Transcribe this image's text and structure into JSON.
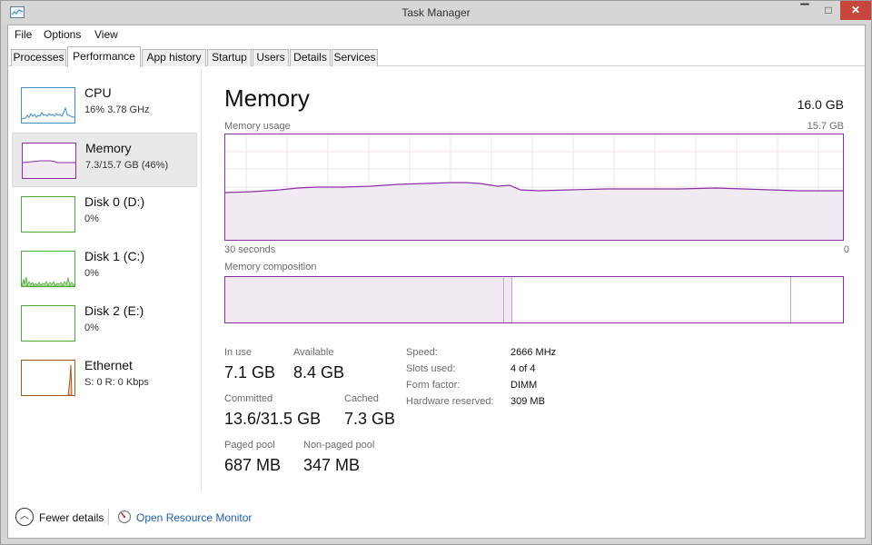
{
  "window": {
    "title": "Task Manager",
    "minimize_glyph": "▔",
    "maximize_glyph": "□",
    "close_glyph": "✕"
  },
  "menu": {
    "items": [
      "File",
      "Options",
      "View"
    ]
  },
  "tabs": [
    {
      "label": "Processes",
      "active": false
    },
    {
      "label": "Performance",
      "active": true
    },
    {
      "label": "App history",
      "active": false
    },
    {
      "label": "Startup",
      "active": false
    },
    {
      "label": "Users",
      "active": false
    },
    {
      "label": "Details",
      "active": false
    },
    {
      "label": "Services",
      "active": false
    }
  ],
  "sidebar": {
    "items": [
      {
        "name": "CPU",
        "sub": "16%  3.78 GHz",
        "color": "#3c8ec8",
        "icon": "cpu-graph-icon"
      },
      {
        "name": "Memory",
        "sub": "7.3/15.7 GB (46%)",
        "color": "#8b2fa6",
        "icon": "memory-graph-icon"
      },
      {
        "name": "Disk 0 (D:)",
        "sub": "0%",
        "color": "#4daa3a",
        "icon": "disk-graph-icon"
      },
      {
        "name": "Disk 1 (C:)",
        "sub": "0%",
        "color": "#4daa3a",
        "icon": "disk-graph-icon"
      },
      {
        "name": "Disk 2 (E:)",
        "sub": "0%",
        "color": "#4daa3a",
        "icon": "disk-graph-icon"
      },
      {
        "name": "Ethernet",
        "sub": "S: 0 R: 0 Kbps",
        "color": "#a75a14",
        "icon": "ethernet-graph-icon"
      }
    ]
  },
  "main": {
    "title": "Memory",
    "total": "16.0 GB",
    "usage_label": "Memory usage",
    "usage_max": "15.7 GB",
    "time_left": "30 seconds",
    "time_right": "0",
    "composition_label": "Memory composition",
    "stats": {
      "in_use_label": "In use",
      "in_use": "7.1 GB",
      "available_label": "Available",
      "available": "8.4 GB",
      "committed_label": "Committed",
      "committed": "13.6/31.5 GB",
      "cached_label": "Cached",
      "cached": "7.3 GB",
      "paged_label": "Paged pool",
      "paged": "687 MB",
      "nonpaged_label": "Non-paged pool",
      "nonpaged": "347 MB"
    },
    "specs": [
      {
        "label": "Speed:",
        "value": "2666 MHz"
      },
      {
        "label": "Slots used:",
        "value": "4 of 4"
      },
      {
        "label": "Form factor:",
        "value": "DIMM"
      },
      {
        "label": "Hardware reserved:",
        "value": "309 MB"
      }
    ]
  },
  "footer": {
    "fewer_details": "Fewer details",
    "fewer_glyph": "︿",
    "open_resource_monitor": "Open Resource Monitor"
  },
  "colors": {
    "memory": "#8b2fa6",
    "memory_fill": "#f1eaf3",
    "link": "#1f5fb0",
    "close_button": "#c7463c"
  }
}
